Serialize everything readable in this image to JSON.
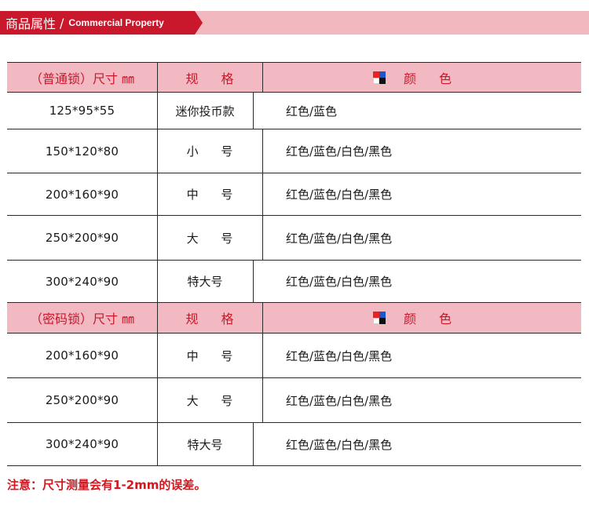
{
  "banner": {
    "title_cn": "商品属性",
    "separator": "/",
    "title_en": "Commercial Property"
  },
  "table1": {
    "header": {
      "col1": "（普通锁）尺寸 ㎜",
      "col2": "规 格",
      "col3": "颜 色"
    },
    "rows": [
      {
        "size": "125*95*55",
        "spec": "迷你投币款",
        "colors": "红色/蓝色"
      },
      {
        "size": "150*120*80",
        "spec": "小 号",
        "colors": "红色/蓝色/白色/黑色"
      },
      {
        "size": "200*160*90",
        "spec": "中 号",
        "colors": "红色/蓝色/白色/黑色"
      },
      {
        "size": "250*200*90",
        "spec": "大 号",
        "colors": "红色/蓝色/白色/黑色"
      },
      {
        "size": "300*240*90",
        "spec": "特大号",
        "colors": "红色/蓝色/白色/黑色"
      }
    ]
  },
  "table2": {
    "header": {
      "col1": "（密码锁）尺寸 ㎜",
      "col2": "规 格",
      "col3": "颜 色"
    },
    "rows": [
      {
        "size": "200*160*90",
        "spec": "中 号",
        "colors": "红色/蓝色/白色/黑色"
      },
      {
        "size": "250*200*90",
        "spec": "大 号",
        "colors": "红色/蓝色/白色/黑色"
      },
      {
        "size": "300*240*90",
        "spec": "特大号",
        "colors": "红色/蓝色/白色/黑色"
      }
    ]
  },
  "note": "注意：尺寸测量会有1-2mm的误差。",
  "colors": {
    "accent_red": "#c9182b",
    "header_pink": "#f2b9c2",
    "note_red": "#d4171f"
  },
  "icons": {
    "color_swatch": "color-swatch-icon"
  }
}
